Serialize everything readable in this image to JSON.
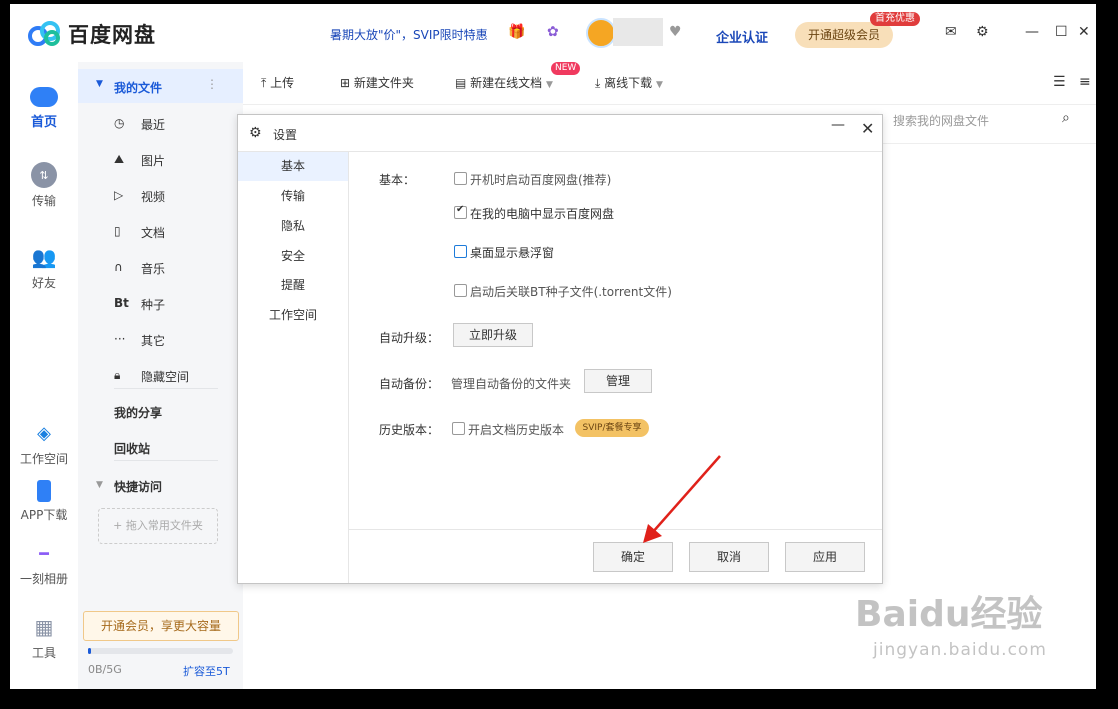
{
  "app": {
    "name": "百度网盘",
    "promo": "暑期大放\"价\"，SVIP限时特惠",
    "enterprise": "企业认证",
    "super_member": "开通超级会员",
    "first_badge": "首充优惠"
  },
  "sidebar": {
    "items": [
      {
        "label": "首页"
      },
      {
        "label": "传输"
      },
      {
        "label": "好友"
      },
      {
        "label": "工作空间"
      },
      {
        "label": "APP下载"
      },
      {
        "label": "一刻相册"
      },
      {
        "label": "工具"
      }
    ]
  },
  "tree": {
    "my_files": "我的文件",
    "items": [
      {
        "label": "最近"
      },
      {
        "label": "图片"
      },
      {
        "label": "视频"
      },
      {
        "label": "文档"
      },
      {
        "label": "音乐"
      },
      {
        "label": "种子"
      },
      {
        "label": "其它"
      },
      {
        "label": "隐藏空间"
      }
    ],
    "my_share": "我的分享",
    "recycle": "回收站",
    "quick_access": "快捷访问",
    "drag_hint": "+ 拖入常用文件夹",
    "vip_box": "开通会员，享更大容量",
    "storage": "0B/5G",
    "expand": "扩容至5T"
  },
  "toolbar": {
    "upload": "上传",
    "new_folder": "新建文件夹",
    "new_online_doc": "新建在线文档",
    "new_badge": "NEW",
    "offline_download": "离线下载",
    "search_placeholder": "搜索我的网盘文件"
  },
  "dialog": {
    "title": "设置",
    "nav": [
      {
        "label": "基本"
      },
      {
        "label": "传输"
      },
      {
        "label": "隐私"
      },
      {
        "label": "安全"
      },
      {
        "label": "提醒"
      },
      {
        "label": "工作空间"
      }
    ],
    "basic_label": "基本：",
    "options": [
      {
        "label": "开机时启动百度网盘(推荐)",
        "checked": false
      },
      {
        "label": "在我的电脑中显示百度网盘",
        "checked": true
      },
      {
        "label": "桌面显示悬浮窗",
        "checked": false
      },
      {
        "label": "启动后关联BT种子文件(.torrent文件)",
        "checked": false
      }
    ],
    "auto_upgrade_label": "自动升级：",
    "upgrade_now": "立即升级",
    "auto_backup_label": "自动备份：",
    "backup_desc": "管理自动备份的文件夹",
    "manage": "管理",
    "history_label": "历史版本：",
    "history_option": "开启文档历史版本",
    "svip_badge": "SVIP/套餐专享",
    "ok": "确定",
    "cancel": "取消",
    "apply": "应用"
  },
  "watermark": {
    "brand": "Baidu经验",
    "url": "jingyan.baidu.com"
  },
  "colors": {
    "accent": "#1a5ad8",
    "arrow": "#e0211a",
    "vip_gold": "#f3c264"
  }
}
